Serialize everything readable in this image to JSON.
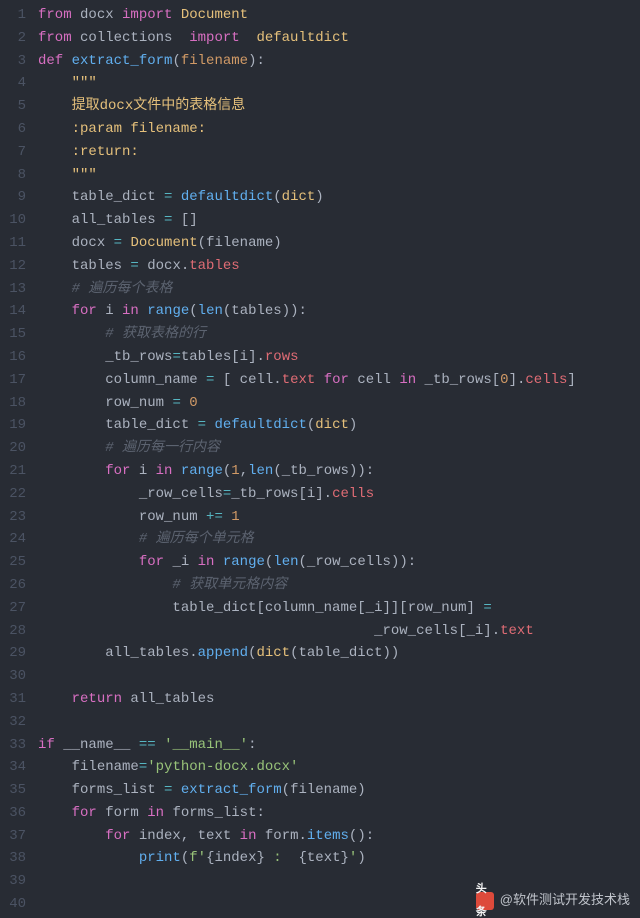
{
  "watermark": {
    "logo_text": "头条",
    "handle": "@软件测试开发技术栈"
  },
  "lines": [
    [
      [
        "from ",
        "kw"
      ],
      [
        "docx ",
        "wht"
      ],
      [
        "import ",
        "kw"
      ],
      [
        "Document",
        "cls"
      ]
    ],
    [
      [
        "from ",
        "kw"
      ],
      [
        "collections  ",
        "wht"
      ],
      [
        "import  ",
        "kw"
      ],
      [
        "defaultdict",
        "cls"
      ]
    ],
    [
      [
        "def ",
        "kw"
      ],
      [
        "extract_form",
        "fn"
      ],
      [
        "(",
        "pn"
      ],
      [
        "filename",
        "prm"
      ],
      [
        "):",
        "pn"
      ]
    ],
    [
      [
        "    ",
        ""
      ],
      [
        "\"\"\"",
        "doc"
      ]
    ],
    [
      [
        "    ",
        ""
      ],
      [
        "提取docx文件中的表格信息",
        "doc"
      ]
    ],
    [
      [
        "    ",
        ""
      ],
      [
        ":param filename:",
        "doc"
      ]
    ],
    [
      [
        "    ",
        ""
      ],
      [
        ":return:",
        "doc"
      ]
    ],
    [
      [
        "    ",
        ""
      ],
      [
        "\"\"\"",
        "doc"
      ]
    ],
    [
      [
        "    ",
        ""
      ],
      [
        "table_dict ",
        "wht"
      ],
      [
        "= ",
        "op"
      ],
      [
        "defaultdict",
        "fn"
      ],
      [
        "(",
        "pn"
      ],
      [
        "dict",
        "cls"
      ],
      [
        ")",
        "pn"
      ]
    ],
    [
      [
        "    ",
        ""
      ],
      [
        "all_tables ",
        "wht"
      ],
      [
        "= ",
        "op"
      ],
      [
        "[]",
        "pn"
      ]
    ],
    [
      [
        "    ",
        ""
      ],
      [
        "docx ",
        "wht"
      ],
      [
        "= ",
        "op"
      ],
      [
        "Document",
        "cls"
      ],
      [
        "(",
        "pn"
      ],
      [
        "filename",
        "wht"
      ],
      [
        ")",
        "pn"
      ]
    ],
    [
      [
        "    ",
        ""
      ],
      [
        "tables ",
        "wht"
      ],
      [
        "= ",
        "op"
      ],
      [
        "docx",
        "wht"
      ],
      [
        ".",
        "pn"
      ],
      [
        "tables",
        "var"
      ]
    ],
    [
      [
        "    ",
        ""
      ],
      [
        "# 遍历每个表格",
        "cmt"
      ]
    ],
    [
      [
        "    ",
        ""
      ],
      [
        "for ",
        "kw"
      ],
      [
        "i ",
        "wht"
      ],
      [
        "in ",
        "kw"
      ],
      [
        "range",
        "fn"
      ],
      [
        "(",
        "pn"
      ],
      [
        "len",
        "fn"
      ],
      [
        "(",
        "pn"
      ],
      [
        "tables",
        "wht"
      ],
      [
        ")):",
        "pn"
      ]
    ],
    [
      [
        "        ",
        ""
      ],
      [
        "# 获取表格的行",
        "cmt"
      ]
    ],
    [
      [
        "        ",
        ""
      ],
      [
        "_tb_rows",
        "wht"
      ],
      [
        "=",
        "op"
      ],
      [
        "tables",
        "wht"
      ],
      [
        "[",
        "pn"
      ],
      [
        "i",
        "wht"
      ],
      [
        "].",
        "pn"
      ],
      [
        "rows",
        "var"
      ]
    ],
    [
      [
        "        ",
        ""
      ],
      [
        "column_name ",
        "wht"
      ],
      [
        "= ",
        "op"
      ],
      [
        "[ ",
        "pn"
      ],
      [
        "cell",
        "wht"
      ],
      [
        ".",
        "pn"
      ],
      [
        "text ",
        "var"
      ],
      [
        "for ",
        "kw"
      ],
      [
        "cell ",
        "wht"
      ],
      [
        "in ",
        "kw"
      ],
      [
        "_tb_rows",
        "wht"
      ],
      [
        "[",
        "pn"
      ],
      [
        "0",
        "num"
      ],
      [
        "].",
        "pn"
      ],
      [
        "cells",
        "var"
      ],
      [
        "]",
        "pn"
      ]
    ],
    [
      [
        "        ",
        ""
      ],
      [
        "row_num ",
        "wht"
      ],
      [
        "= ",
        "op"
      ],
      [
        "0",
        "num"
      ]
    ],
    [
      [
        "        ",
        ""
      ],
      [
        "table_dict ",
        "wht"
      ],
      [
        "= ",
        "op"
      ],
      [
        "defaultdict",
        "fn"
      ],
      [
        "(",
        "pn"
      ],
      [
        "dict",
        "cls"
      ],
      [
        ")",
        "pn"
      ]
    ],
    [
      [
        "        ",
        ""
      ],
      [
        "# 遍历每一行内容",
        "cmt"
      ]
    ],
    [
      [
        "        ",
        ""
      ],
      [
        "for ",
        "kw"
      ],
      [
        "i ",
        "wht"
      ],
      [
        "in ",
        "kw"
      ],
      [
        "range",
        "fn"
      ],
      [
        "(",
        "pn"
      ],
      [
        "1",
        "num"
      ],
      [
        ",",
        "pn"
      ],
      [
        "len",
        "fn"
      ],
      [
        "(",
        "pn"
      ],
      [
        "_tb_rows",
        "wht"
      ],
      [
        ")):",
        "pn"
      ]
    ],
    [
      [
        "            ",
        ""
      ],
      [
        "_row_cells",
        "wht"
      ],
      [
        "=",
        "op"
      ],
      [
        "_tb_rows",
        "wht"
      ],
      [
        "[",
        "pn"
      ],
      [
        "i",
        "wht"
      ],
      [
        "].",
        "pn"
      ],
      [
        "cells",
        "var"
      ]
    ],
    [
      [
        "            ",
        ""
      ],
      [
        "row_num ",
        "wht"
      ],
      [
        "+= ",
        "op"
      ],
      [
        "1",
        "num"
      ]
    ],
    [
      [
        "            ",
        ""
      ],
      [
        "# 遍历每个单元格",
        "cmt"
      ]
    ],
    [
      [
        "            ",
        ""
      ],
      [
        "for ",
        "kw"
      ],
      [
        "_i ",
        "wht"
      ],
      [
        "in ",
        "kw"
      ],
      [
        "range",
        "fn"
      ],
      [
        "(",
        "pn"
      ],
      [
        "len",
        "fn"
      ],
      [
        "(",
        "pn"
      ],
      [
        "_row_cells",
        "wht"
      ],
      [
        ")):",
        "pn"
      ]
    ],
    [
      [
        "                ",
        ""
      ],
      [
        "# 获取单元格内容",
        "cmt"
      ]
    ],
    [
      [
        "                ",
        ""
      ],
      [
        "table_dict",
        "wht"
      ],
      [
        "[",
        "pn"
      ],
      [
        "column_name",
        "wht"
      ],
      [
        "[",
        "pn"
      ],
      [
        "_i",
        "wht"
      ],
      [
        "]][",
        "pn"
      ],
      [
        "row_num",
        "wht"
      ],
      [
        "] ",
        "pn"
      ],
      [
        "= ",
        "op"
      ]
    ],
    [
      [
        "                                        ",
        ""
      ],
      [
        "_row_cells",
        "wht"
      ],
      [
        "[",
        "pn"
      ],
      [
        "_i",
        "wht"
      ],
      [
        "].",
        "pn"
      ],
      [
        "text",
        "var"
      ]
    ],
    [
      [
        "        ",
        ""
      ],
      [
        "all_tables",
        "wht"
      ],
      [
        ".",
        "pn"
      ],
      [
        "append",
        "fn"
      ],
      [
        "(",
        "pn"
      ],
      [
        "dict",
        "cls"
      ],
      [
        "(",
        "pn"
      ],
      [
        "table_dict",
        "wht"
      ],
      [
        "))",
        "pn"
      ]
    ],
    [
      [
        "",
        ""
      ]
    ],
    [
      [
        "    ",
        ""
      ],
      [
        "return ",
        "kw"
      ],
      [
        "all_tables",
        "wht"
      ]
    ],
    [
      [
        "",
        ""
      ]
    ],
    [
      [
        "if ",
        "kw"
      ],
      [
        "__name__ ",
        "wht"
      ],
      [
        "== ",
        "op"
      ],
      [
        "'__main__'",
        "str"
      ],
      [
        ":",
        "pn"
      ]
    ],
    [
      [
        "    ",
        ""
      ],
      [
        "filename",
        "wht"
      ],
      [
        "=",
        "op"
      ],
      [
        "'python-docx.docx'",
        "str"
      ]
    ],
    [
      [
        "    ",
        ""
      ],
      [
        "forms_list ",
        "wht"
      ],
      [
        "= ",
        "op"
      ],
      [
        "extract_form",
        "fn"
      ],
      [
        "(",
        "pn"
      ],
      [
        "filename",
        "wht"
      ],
      [
        ")",
        "pn"
      ]
    ],
    [
      [
        "    ",
        ""
      ],
      [
        "for ",
        "kw"
      ],
      [
        "form ",
        "wht"
      ],
      [
        "in ",
        "kw"
      ],
      [
        "forms_list",
        "wht"
      ],
      [
        ":",
        "pn"
      ]
    ],
    [
      [
        "        ",
        ""
      ],
      [
        "for ",
        "kw"
      ],
      [
        "index",
        "wht"
      ],
      [
        ", ",
        "pn"
      ],
      [
        "text ",
        "wht"
      ],
      [
        "in ",
        "kw"
      ],
      [
        "form",
        "wht"
      ],
      [
        ".",
        "pn"
      ],
      [
        "items",
        "fn"
      ],
      [
        "():",
        "pn"
      ]
    ],
    [
      [
        "            ",
        ""
      ],
      [
        "print",
        "fn"
      ],
      [
        "(",
        "pn"
      ],
      [
        "f'",
        "str"
      ],
      [
        "{",
        "pn"
      ],
      [
        "index",
        "wht"
      ],
      [
        "}",
        "pn"
      ],
      [
        " :  ",
        "str"
      ],
      [
        "{",
        "pn"
      ],
      [
        "text",
        "wht"
      ],
      [
        "}",
        "pn"
      ],
      [
        "'",
        "str"
      ],
      [
        ")",
        "pn"
      ]
    ],
    [
      [
        "",
        ""
      ]
    ],
    [
      [
        "",
        ""
      ]
    ]
  ]
}
